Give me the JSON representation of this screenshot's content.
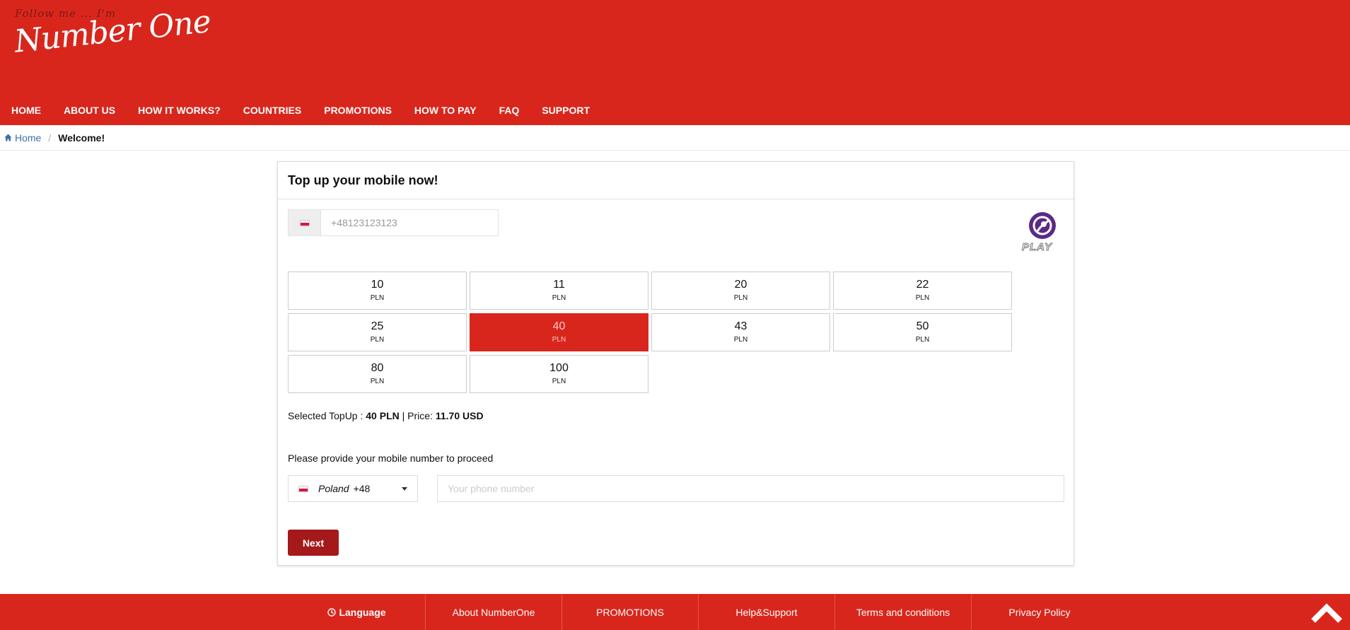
{
  "header": {
    "tagline": "Follow me ... I'm",
    "brand": "Number One",
    "brand_color": "#d9261c"
  },
  "nav": [
    {
      "label": "HOME"
    },
    {
      "label": "ABOUT US"
    },
    {
      "label": "HOW IT WORKS?"
    },
    {
      "label": "COUNTRIES"
    },
    {
      "label": "PROMOTIONS"
    },
    {
      "label": "HOW TO PAY"
    },
    {
      "label": "FAQ"
    },
    {
      "label": "SUPPORT"
    }
  ],
  "breadcrumb": {
    "home_icon": "home-icon",
    "home": "Home",
    "separator": "/",
    "current": "Welcome!"
  },
  "topup": {
    "title": "Top up your mobile now!",
    "phone_value": "+48123123123",
    "flag_icon": "poland-flag-icon",
    "operator": "PLAY",
    "amounts": [
      {
        "amount": "10",
        "currency": "PLN"
      },
      {
        "amount": "11",
        "currency": "PLN"
      },
      {
        "amount": "20",
        "currency": "PLN"
      },
      {
        "amount": "22",
        "currency": "PLN"
      },
      {
        "amount": "25",
        "currency": "PLN"
      },
      {
        "amount": "40",
        "currency": "PLN"
      },
      {
        "amount": "43",
        "currency": "PLN"
      },
      {
        "amount": "50",
        "currency": "PLN"
      },
      {
        "amount": "80",
        "currency": "PLN"
      },
      {
        "amount": "100",
        "currency": "PLN"
      }
    ],
    "selected_index": 5,
    "selected_color": "#d9261c",
    "summary": {
      "label": "Selected TopUp :",
      "selected": "40 PLN",
      "divider": "|",
      "price_label": "Price:",
      "price": "11.70 USD"
    },
    "provide_text": "Please provide your mobile number to proceed",
    "country": {
      "name": "Poland",
      "code": "+48"
    },
    "phone_placeholder": "Your phone number",
    "next_label": "Next",
    "next_color": "#a5191b"
  },
  "footer": {
    "language_icon": "globe-icon",
    "language": "Language",
    "links": [
      {
        "label": "About NumberOne"
      },
      {
        "label": "PROMOTIONS"
      },
      {
        "label": "Help&Support"
      },
      {
        "label": "Terms and conditions"
      },
      {
        "label": "Privacy Policy"
      }
    ],
    "scroll_icon": "chevron-up-icon"
  }
}
